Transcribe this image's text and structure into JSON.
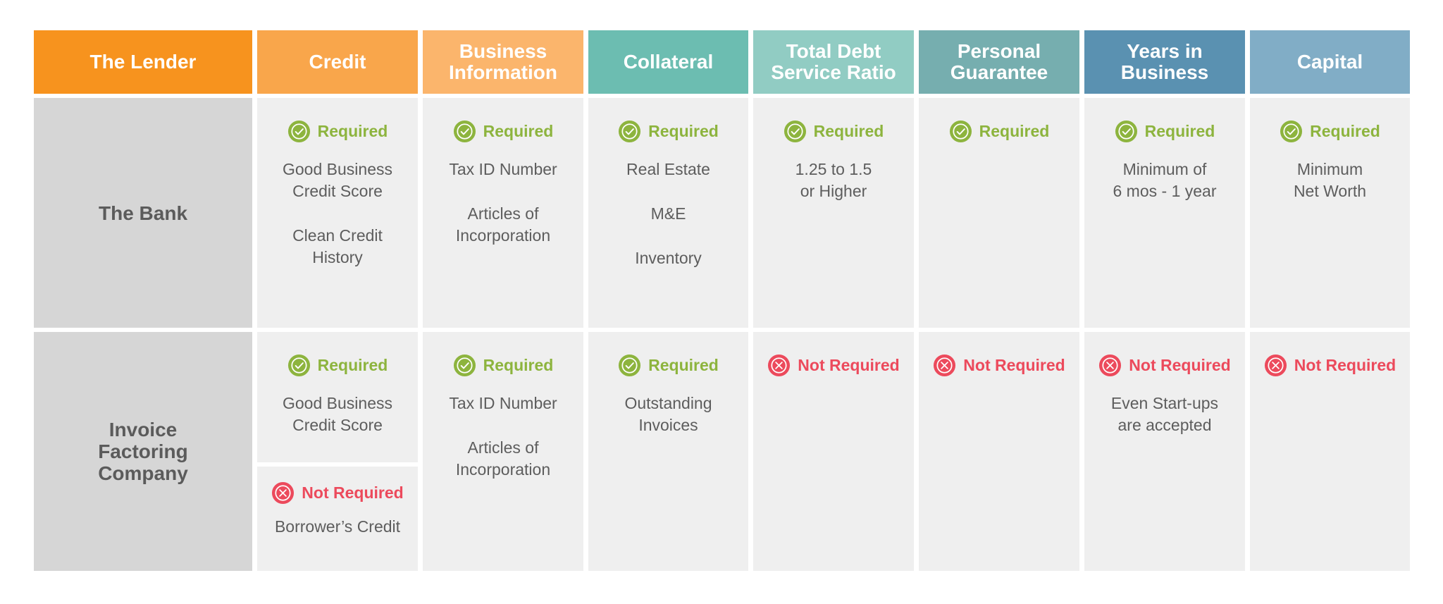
{
  "colors": {
    "header_lender": "#f7931e",
    "header_credit": "#f9a64b",
    "header_business_info": "#fbb56c",
    "header_collateral": "#6cbdb1",
    "header_tdsr": "#91ccc3",
    "header_personal_guarantee": "#76aeaf",
    "header_years": "#5a91b1",
    "header_capital": "#81adc6",
    "required": "#8db43e",
    "not_required": "#ec4a5c",
    "lender_cell": "#d6d6d6",
    "body_cell": "#efefef"
  },
  "headers": [
    {
      "label": "The Lender",
      "color": "#f7931e"
    },
    {
      "label": "Credit",
      "color": "#f9a64b"
    },
    {
      "label": "Business\nInformation",
      "color": "#fbb56c"
    },
    {
      "label": "Collateral",
      "color": "#6cbdb1"
    },
    {
      "label": "Total Debt\nService Ratio",
      "color": "#91ccc3"
    },
    {
      "label": "Personal\nGuarantee",
      "color": "#76aeaf"
    },
    {
      "label": "Years in\nBusiness",
      "color": "#5a91b1"
    },
    {
      "label": "Capital",
      "color": "#81adc6"
    }
  ],
  "status_labels": {
    "required": "Required",
    "not_required": "Not Required"
  },
  "rows": [
    {
      "lender": "The Bank",
      "credit": {
        "status": "Required",
        "items": [
          "Good Business\nCredit Score",
          "Clean Credit\nHistory"
        ]
      },
      "business_information": {
        "status": "Required",
        "items": [
          "Tax ID Number",
          "Articles of\nIncorporation"
        ]
      },
      "collateral": {
        "status": "Required",
        "items": [
          "Real Estate",
          "M&E",
          "Inventory"
        ]
      },
      "total_debt_service_ratio": {
        "status": "Required",
        "items": [
          "1.25 to 1.5\nor Higher"
        ]
      },
      "personal_guarantee": {
        "status": "Required",
        "items": []
      },
      "years_in_business": {
        "status": "Required",
        "items": [
          "Minimum of\n6 mos - 1 year"
        ]
      },
      "capital": {
        "status": "Required",
        "items": [
          "Minimum\nNet Worth"
        ]
      }
    },
    {
      "lender": "Invoice\nFactoring\nCompany",
      "credit": {
        "status": "Required",
        "items": [
          "Good Business\nCredit Score"
        ]
      },
      "credit_borrower": {
        "status": "Not Required",
        "items": [
          "Borrower’s Credit"
        ]
      },
      "business_information": {
        "status": "Required",
        "items": [
          "Tax ID Number",
          "Articles of\nIncorporation"
        ]
      },
      "collateral": {
        "status": "Required",
        "items": [
          "Outstanding\nInvoices"
        ]
      },
      "total_debt_service_ratio": {
        "status": "Not Required",
        "items": []
      },
      "personal_guarantee": {
        "status": "Not Required",
        "items": []
      },
      "years_in_business": {
        "status": "Not Required",
        "items": [
          "Even Start-ups\nare accepted"
        ]
      },
      "capital": {
        "status": "Not Required",
        "items": []
      }
    }
  ]
}
